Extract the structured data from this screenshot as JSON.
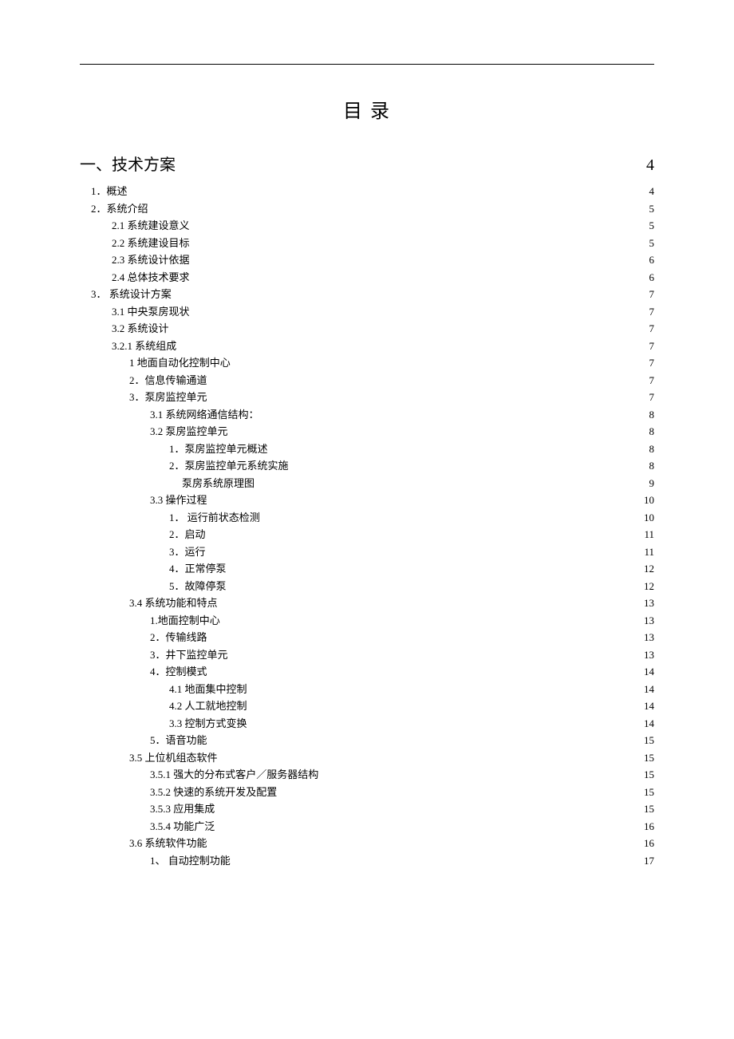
{
  "title": "目 录",
  "toc": [
    {
      "level": "h1",
      "indent": 0,
      "label": "一、技术方案",
      "page": "4"
    },
    {
      "level": "row",
      "indent": 1,
      "label": "1．概述",
      "page": "4"
    },
    {
      "level": "row",
      "indent": 1,
      "label": "2．系统介绍",
      "page": "5"
    },
    {
      "level": "row",
      "indent": 2,
      "label": "2.1 系统建设意义",
      "page": "5"
    },
    {
      "level": "row",
      "indent": 2,
      "label": "2.2 系统建设目标",
      "page": "5"
    },
    {
      "level": "row",
      "indent": 2,
      "label": "2.3  系统设计依据",
      "page": "6"
    },
    {
      "level": "row",
      "indent": 2,
      "label": "2.4  总体技术要求",
      "page": "6"
    },
    {
      "level": "row",
      "indent": 1,
      "label": "3． 系统设计方案",
      "page": "7"
    },
    {
      "level": "row",
      "indent": 2,
      "label": "3.1 中央泵房现状",
      "page": "7"
    },
    {
      "level": "row",
      "indent": 2,
      "label": "3.2 系统设计",
      "page": "7"
    },
    {
      "level": "row",
      "indent": 2,
      "label": "3.2.1 系统组成",
      "page": "7"
    },
    {
      "level": "row",
      "indent": 3,
      "label": "1 地面自动化控制中心",
      "page": "7"
    },
    {
      "level": "row",
      "indent": 3,
      "label": "2．信息传输通道",
      "page": "7"
    },
    {
      "level": "row",
      "indent": 3,
      "label": "3．泵房监控单元",
      "page": "7"
    },
    {
      "level": "row",
      "indent": 4,
      "label": "3.1 系统网络通信结构：",
      "page": "8"
    },
    {
      "level": "row",
      "indent": 4,
      "label": "3.2 泵房监控单元",
      "page": "8"
    },
    {
      "level": "row",
      "indent": 5,
      "label": "1．泵房监控单元概述",
      "page": "8"
    },
    {
      "level": "row",
      "indent": 5,
      "label": "2．泵房监控单元系统实施",
      "page": "8"
    },
    {
      "level": "row",
      "indent": 6,
      "label": "泵房系统原理图",
      "page": "9"
    },
    {
      "level": "row",
      "indent": 4,
      "label": "3.3 操作过程",
      "page": "10"
    },
    {
      "level": "row",
      "indent": 5,
      "label": "1．   运行前状态检测",
      "page": "10"
    },
    {
      "level": "row",
      "indent": 5,
      "label": "2．启动",
      "page": "11"
    },
    {
      "level": "row",
      "indent": 5,
      "label": "3．运行",
      "page": "11"
    },
    {
      "level": "row",
      "indent": 5,
      "label": "4．正常停泵",
      "page": "12"
    },
    {
      "level": "row",
      "indent": 5,
      "label": "5．故障停泵",
      "page": "12"
    },
    {
      "level": "row",
      "indent": 3,
      "label": "3.4  系统功能和特点",
      "page": "13"
    },
    {
      "level": "row",
      "indent": 4,
      "label": "1.地面控制中心",
      "page": "13"
    },
    {
      "level": "row",
      "indent": 4,
      "label": "2．传输线路",
      "page": "13"
    },
    {
      "level": "row",
      "indent": 4,
      "label": "3．井下监控单元",
      "page": "13"
    },
    {
      "level": "row",
      "indent": 4,
      "label": "4．控制模式",
      "page": "14"
    },
    {
      "level": "row",
      "indent": 5,
      "label": "4.1  地面集中控制",
      "page": "14"
    },
    {
      "level": "row",
      "indent": 5,
      "label": "4.2  人工就地控制",
      "page": "14"
    },
    {
      "level": "row",
      "indent": 5,
      "label": "3.3 控制方式变换",
      "page": "14"
    },
    {
      "level": "row",
      "indent": 4,
      "label": "5．语音功能",
      "page": "15"
    },
    {
      "level": "row",
      "indent": 3,
      "label": "3.5  上位机组态软件",
      "page": "15"
    },
    {
      "level": "row",
      "indent": 4,
      "label": "3.5.1  强大的分布式客户／服务器结构",
      "page": "15"
    },
    {
      "level": "row",
      "indent": 4,
      "label": "3.5.2  快速的系统开发及配置",
      "page": "15"
    },
    {
      "level": "row",
      "indent": 4,
      "label": "3.5.3  应用集成",
      "page": "15"
    },
    {
      "level": "row",
      "indent": 4,
      "label": "3.5.4  功能广泛",
      "page": "16"
    },
    {
      "level": "row",
      "indent": 3,
      "label": "3.6  系统软件功能",
      "page": "16"
    },
    {
      "level": "row",
      "indent": 4,
      "label": "1、 自动控制功能",
      "page": "17"
    }
  ]
}
